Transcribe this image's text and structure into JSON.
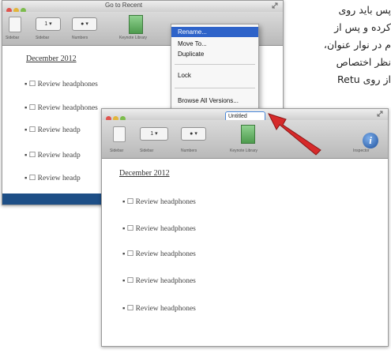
{
  "article": {
    "lines": [
      "پس باید روی",
      "کرده و پس از",
      "م در نوار عنوان،",
      "نظر اختصاص",
      "از روی Retu"
    ]
  },
  "back_window": {
    "title": "Go to Recent",
    "toolbar_labels": [
      "Sidebar",
      "Sidebar",
      "Numbers",
      "Keynote Library"
    ],
    "heading": "December 2012",
    "items": [
      "Review headphones",
      "Review headphones",
      "Review headp",
      "Review headp",
      "Review headp"
    ]
  },
  "menu": {
    "items": [
      "Rename...",
      "Move To...",
      "Duplicate",
      "Lock",
      "Browse All Versions..."
    ],
    "highlighted_index": 0
  },
  "front_window": {
    "rename_value": "Untitled",
    "toolbar_labels": [
      "Sidebar",
      "Sidebar",
      "Numbers",
      "Keynote Library",
      "Inspector"
    ],
    "heading": "December 2012",
    "items": [
      "Review headphones",
      "Review headphones",
      "Review headphones",
      "Review headphones",
      "Review headphones"
    ]
  },
  "colors": {
    "highlight": "#2e63c9",
    "arrow": "#d62a2a",
    "strip": "#1d4e86"
  },
  "icons": [
    "close-light",
    "minimize-light",
    "zoom-light",
    "fullscreen-icon",
    "calendar-icon",
    "info-icon",
    "red-arrow-icon"
  ]
}
